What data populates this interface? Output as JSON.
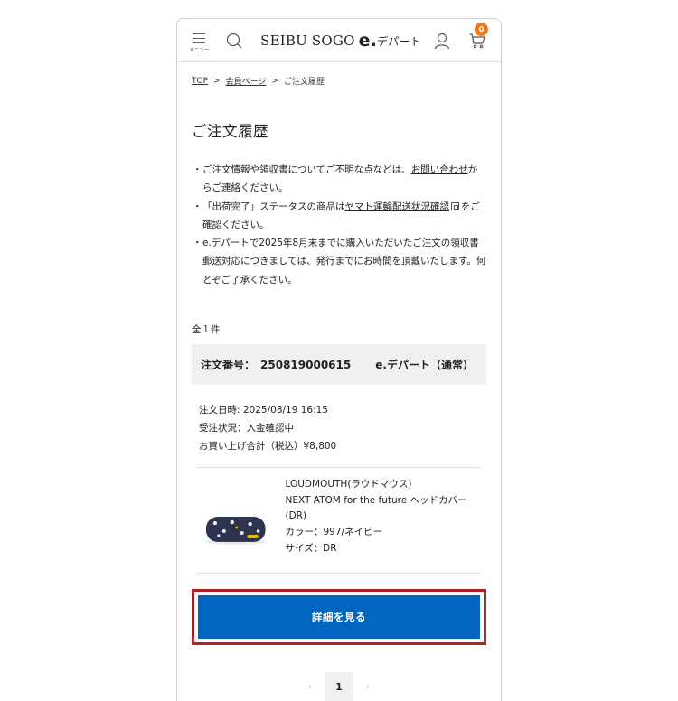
{
  "header": {
    "menu_label": "メニュー",
    "logo_brand": "SEIBU SOGO",
    "logo_e": "e.",
    "logo_suffix": "デパート",
    "cart_count": "0",
    "cart_badge_color": "#f07a1a"
  },
  "breadcrumb": {
    "items": [
      "TOP",
      "会員ページ",
      "ご注文履歴"
    ],
    "separator": ">"
  },
  "page_title": "ご注文履歴",
  "notes": {
    "n1_text": "ご注文情報や領収書についてご不明な点などは、",
    "n1_link": "お問い合わせ",
    "n1_tail": "からご連絡ください。",
    "n2_text": "「出荷完了」ステータスの商品は",
    "n2_link": "ヤマト運輸配送状況確認",
    "n2_tail": "をご確認ください。",
    "n3_text": "e.デパートで2025年8月末までに購入いただいたご注文の領収書郵送対応につきましては、発行までにお時間を頂戴いたします。何とぞご了承ください。",
    "bullet": "・"
  },
  "total_count": "全１件",
  "order": {
    "number_label": "注文番号：",
    "number": "250819000615",
    "shop": "e.デパート（通常）",
    "date": "注文日時: 2025/08/19 16:15",
    "status": "受注状況：入金確認中",
    "amount": "お買い上げ合計（税込）¥8,800"
  },
  "product": {
    "brand": "LOUDMOUTH(ラウドマウス)",
    "name": "NEXT ATOM for the future ヘッドカバー(DR)",
    "color": "カラー：997/ネイビー",
    "size": "サイズ：DR",
    "icon": "headcover-thumbnail"
  },
  "detail_button": "詳細を見る",
  "colors": {
    "accent": "#0066c0",
    "highlight_border": "#b01e27"
  },
  "pager": {
    "prev": "‹",
    "current": "1",
    "next": "›"
  }
}
